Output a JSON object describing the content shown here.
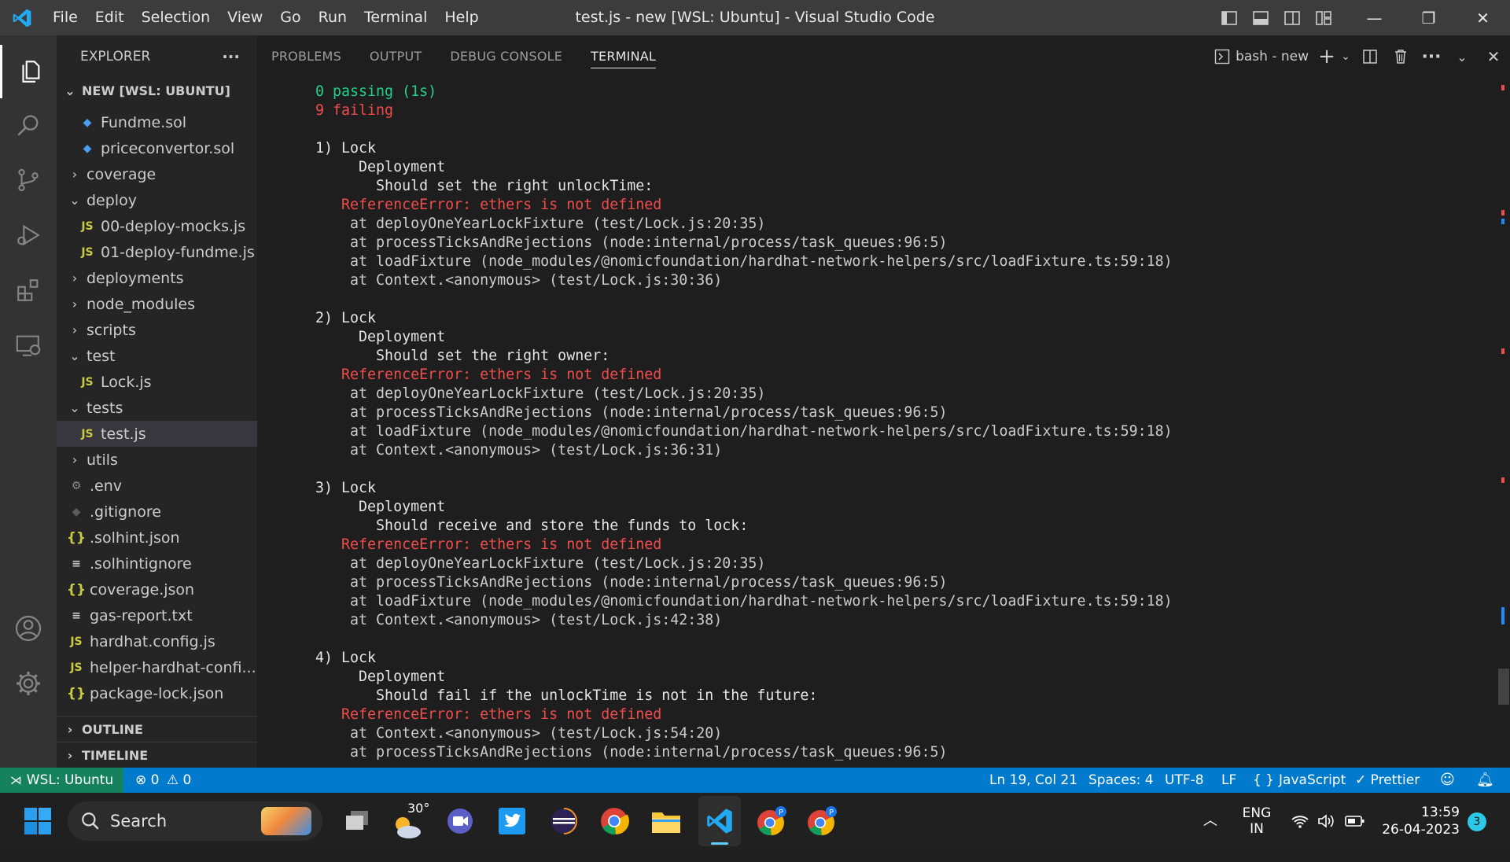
{
  "window": {
    "title": "test.js - new [WSL: Ubuntu] - Visual Studio Code",
    "menu": [
      "File",
      "Edit",
      "Selection",
      "View",
      "Go",
      "Run",
      "Terminal",
      "Help"
    ],
    "controls": {
      "minimize": "—",
      "restore": "❐",
      "close": "✕"
    }
  },
  "activity_bar": [
    "explorer",
    "search",
    "source-control",
    "run-debug",
    "extensions",
    "remote-explorer",
    "accounts",
    "manage"
  ],
  "explorer": {
    "header": "EXPLORER",
    "more": "···",
    "root_label": "NEW [WSL: UBUNTU]",
    "items": [
      {
        "label": "Fundme.sol",
        "icon": "sol",
        "depth": 1
      },
      {
        "label": "priceconvertor.sol",
        "icon": "sol",
        "depth": 1
      },
      {
        "label": "coverage",
        "icon": "folder-closed",
        "depth": 0
      },
      {
        "label": "deploy",
        "icon": "folder-open",
        "depth": 0
      },
      {
        "label": "00-deploy-mocks.js",
        "icon": "js",
        "depth": 1
      },
      {
        "label": "01-deploy-fundme.js",
        "icon": "js",
        "depth": 1
      },
      {
        "label": "deployments",
        "icon": "folder-closed",
        "depth": 0
      },
      {
        "label": "node_modules",
        "icon": "folder-closed",
        "depth": 0
      },
      {
        "label": "scripts",
        "icon": "folder-closed",
        "depth": 0
      },
      {
        "label": "test",
        "icon": "folder-open",
        "depth": 0
      },
      {
        "label": "Lock.js",
        "icon": "js",
        "depth": 1
      },
      {
        "label": "tests",
        "icon": "folder-open",
        "depth": 0
      },
      {
        "label": "test.js",
        "icon": "js",
        "depth": 1,
        "selected": true
      },
      {
        "label": "utils",
        "icon": "folder-closed",
        "depth": 0
      },
      {
        "label": ".env",
        "icon": "gear",
        "depth": 0
      },
      {
        "label": ".gitignore",
        "icon": "git",
        "depth": 0
      },
      {
        "label": ".solhint.json",
        "icon": "json",
        "depth": 0
      },
      {
        "label": ".solhintignore",
        "icon": "lines",
        "depth": 0
      },
      {
        "label": "coverage.json",
        "icon": "json",
        "depth": 0
      },
      {
        "label": "gas-report.txt",
        "icon": "lines",
        "depth": 0
      },
      {
        "label": "hardhat.config.js",
        "icon": "js",
        "depth": 0
      },
      {
        "label": "helper-hardhat-confi...",
        "icon": "js",
        "depth": 0
      },
      {
        "label": "package-lock.json",
        "icon": "json",
        "depth": 0
      }
    ],
    "outline": "OUTLINE",
    "timeline": "TIMELINE"
  },
  "panel": {
    "tabs": [
      "PROBLEMS",
      "OUTPUT",
      "DEBUG CONSOLE",
      "TERMINAL"
    ],
    "active_tab": "TERMINAL",
    "terminal_name": "bash - new"
  },
  "terminal_lines": [
    {
      "text": "  0 passing (1s)",
      "color": "green"
    },
    {
      "text": "  9 failing",
      "color": "red"
    },
    {
      "text": "",
      "color": "white"
    },
    {
      "text": "  1) Lock",
      "color": "white"
    },
    {
      "text": "       Deployment",
      "color": "white"
    },
    {
      "text": "         Should set the right unlockTime:",
      "color": "white"
    },
    {
      "text": "     ReferenceError: ethers is not defined",
      "color": "red"
    },
    {
      "text": "      at deployOneYearLockFixture (test/Lock.js:20:35)",
      "color": "gray"
    },
    {
      "text": "      at processTicksAndRejections (node:internal/process/task_queues:96:5)",
      "color": "gray"
    },
    {
      "text": "      at loadFixture (node_modules/@nomicfoundation/hardhat-network-helpers/src/loadFixture.ts:59:18)",
      "color": "gray"
    },
    {
      "text": "      at Context.<anonymous> (test/Lock.js:30:36)",
      "color": "gray"
    },
    {
      "text": "",
      "color": "white"
    },
    {
      "text": "  2) Lock",
      "color": "white"
    },
    {
      "text": "       Deployment",
      "color": "white"
    },
    {
      "text": "         Should set the right owner:",
      "color": "white"
    },
    {
      "text": "     ReferenceError: ethers is not defined",
      "color": "red"
    },
    {
      "text": "      at deployOneYearLockFixture (test/Lock.js:20:35)",
      "color": "gray"
    },
    {
      "text": "      at processTicksAndRejections (node:internal/process/task_queues:96:5)",
      "color": "gray"
    },
    {
      "text": "      at loadFixture (node_modules/@nomicfoundation/hardhat-network-helpers/src/loadFixture.ts:59:18)",
      "color": "gray"
    },
    {
      "text": "      at Context.<anonymous> (test/Lock.js:36:31)",
      "color": "gray"
    },
    {
      "text": "",
      "color": "white"
    },
    {
      "text": "  3) Lock",
      "color": "white"
    },
    {
      "text": "       Deployment",
      "color": "white"
    },
    {
      "text": "         Should receive and store the funds to lock:",
      "color": "white"
    },
    {
      "text": "     ReferenceError: ethers is not defined",
      "color": "red"
    },
    {
      "text": "      at deployOneYearLockFixture (test/Lock.js:20:35)",
      "color": "gray"
    },
    {
      "text": "      at processTicksAndRejections (node:internal/process/task_queues:96:5)",
      "color": "gray"
    },
    {
      "text": "      at loadFixture (node_modules/@nomicfoundation/hardhat-network-helpers/src/loadFixture.ts:59:18)",
      "color": "gray"
    },
    {
      "text": "      at Context.<anonymous> (test/Lock.js:42:38)",
      "color": "gray"
    },
    {
      "text": "",
      "color": "white"
    },
    {
      "text": "  4) Lock",
      "color": "white"
    },
    {
      "text": "       Deployment",
      "color": "white"
    },
    {
      "text": "         Should fail if the unlockTime is not in the future:",
      "color": "white"
    },
    {
      "text": "     ReferenceError: ethers is not defined",
      "color": "red"
    },
    {
      "text": "      at Context.<anonymous> (test/Lock.js:54:20)",
      "color": "gray"
    },
    {
      "text": "      at processTicksAndRejections (node:internal/process/task_queues:96:5)",
      "color": "gray"
    }
  ],
  "status_bar": {
    "remote": "WSL: Ubuntu",
    "errors": "0",
    "warnings": "0",
    "position": "Ln 19, Col 21",
    "spaces": "Spaces: 4",
    "encoding": "UTF-8",
    "eol": "LF",
    "language": "JavaScript",
    "language_icon": "{ }",
    "formatter": "Prettier"
  },
  "taskbar": {
    "search": "Search",
    "weather": "30°",
    "language_line1": "ENG",
    "language_line2": "IN",
    "time": "13:59",
    "date": "26-04-2023",
    "notifications": "3"
  },
  "colors": {
    "statusbar": "#007acc",
    "remote": "#16825d",
    "terminal_green": "#23d18b",
    "terminal_red": "#f14c4c",
    "sidebar": "#252526",
    "titlebar": "#3c3c3c"
  }
}
